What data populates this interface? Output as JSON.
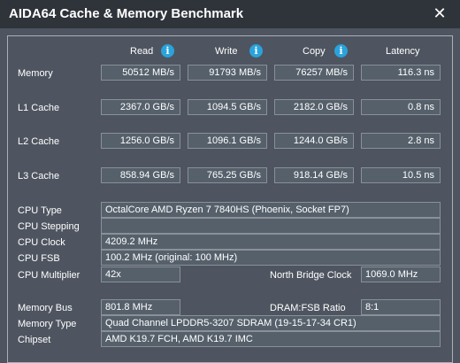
{
  "window": {
    "title": "AIDA64 Cache & Memory Benchmark",
    "close_glyph": "✕"
  },
  "headers": {
    "read": "Read",
    "write": "Write",
    "copy": "Copy",
    "latency": "Latency",
    "info_glyph": "i"
  },
  "rows": [
    {
      "label": "Memory",
      "read": "50512 MB/s",
      "write": "91793 MB/s",
      "copy": "76257 MB/s",
      "latency": "116.3 ns"
    },
    {
      "label": "L1 Cache",
      "read": "2367.0 GB/s",
      "write": "1094.5 GB/s",
      "copy": "2182.0 GB/s",
      "latency": "0.8 ns"
    },
    {
      "label": "L2 Cache",
      "read": "1256.0 GB/s",
      "write": "1096.1 GB/s",
      "copy": "1244.0 GB/s",
      "latency": "2.8 ns"
    },
    {
      "label": "L3 Cache",
      "read": "858.94 GB/s",
      "write": "765.25 GB/s",
      "copy": "918.14 GB/s",
      "latency": "10.5 ns"
    }
  ],
  "info": {
    "cpu_type": {
      "label": "CPU Type",
      "value": "OctalCore AMD Ryzen 7 7840HS  (Phoenix, Socket FP7)"
    },
    "cpu_stepping": {
      "label": "CPU Stepping",
      "value": ""
    },
    "cpu_clock": {
      "label": "CPU Clock",
      "value": "4209.2 MHz"
    },
    "cpu_fsb": {
      "label": "CPU FSB",
      "value": "100.2 MHz  (original: 100 MHz)"
    },
    "cpu_multiplier": {
      "label": "CPU Multiplier",
      "value": "42x"
    },
    "north_bridge_clock": {
      "label": "North Bridge Clock",
      "value": "1069.0 MHz"
    },
    "memory_bus": {
      "label": "Memory Bus",
      "value": "801.8 MHz"
    },
    "dram_fsb_ratio": {
      "label": "DRAM:FSB Ratio",
      "value": "8:1"
    },
    "memory_type": {
      "label": "Memory Type",
      "value": "Quad Channel LPDDR5-3207 SDRAM  (19-15-17-34 CR1)"
    },
    "chipset": {
      "label": "Chipset",
      "value": "AMD K19.7 FCH, AMD K19.7 IMC"
    }
  }
}
